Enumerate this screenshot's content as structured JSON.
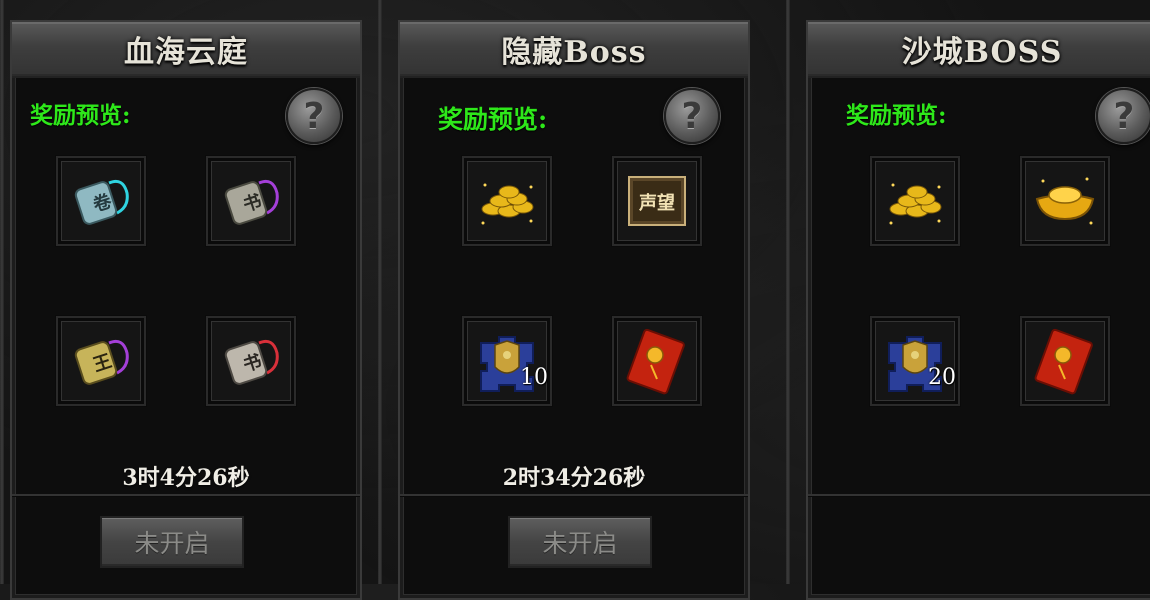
{
  "panels": [
    {
      "title": "血海云庭",
      "reward_label": "奖励预览:",
      "help_label": "?",
      "rewards": [
        {
          "icon": "cyan-token-icon",
          "count": ""
        },
        {
          "icon": "purple-token-icon",
          "count": ""
        },
        {
          "icon": "gold-token-icon",
          "count": ""
        },
        {
          "icon": "red-token-icon",
          "count": ""
        }
      ],
      "timer": "3时4分26秒",
      "button_label": "未开启"
    },
    {
      "title": "隐藏Boss",
      "reward_label": "奖励预览:",
      "help_label": "?",
      "rewards": [
        {
          "icon": "gold-coins-icon",
          "count": ""
        },
        {
          "icon": "reputation-scroll-icon",
          "count": "",
          "text": "声望"
        },
        {
          "icon": "armor-fragment-icon",
          "count": "10"
        },
        {
          "icon": "red-envelope-icon",
          "count": ""
        }
      ],
      "timer": "2时34分26秒",
      "button_label": "未开启"
    },
    {
      "title": "沙城BOSS",
      "reward_label": "奖励预览:",
      "help_label": "?",
      "rewards": [
        {
          "icon": "gold-coins-icon",
          "count": ""
        },
        {
          "icon": "gold-ingot-icon",
          "count": ""
        },
        {
          "icon": "armor-fragment-icon",
          "count": "20"
        },
        {
          "icon": "red-envelope-icon",
          "count": ""
        }
      ],
      "timer": "",
      "button_label": ""
    }
  ],
  "colors": {
    "reward_label": "#2ee81a",
    "title_text": "#e6e3d8",
    "timer_text": "#f0eee6",
    "button_text": "#8b8b88"
  }
}
